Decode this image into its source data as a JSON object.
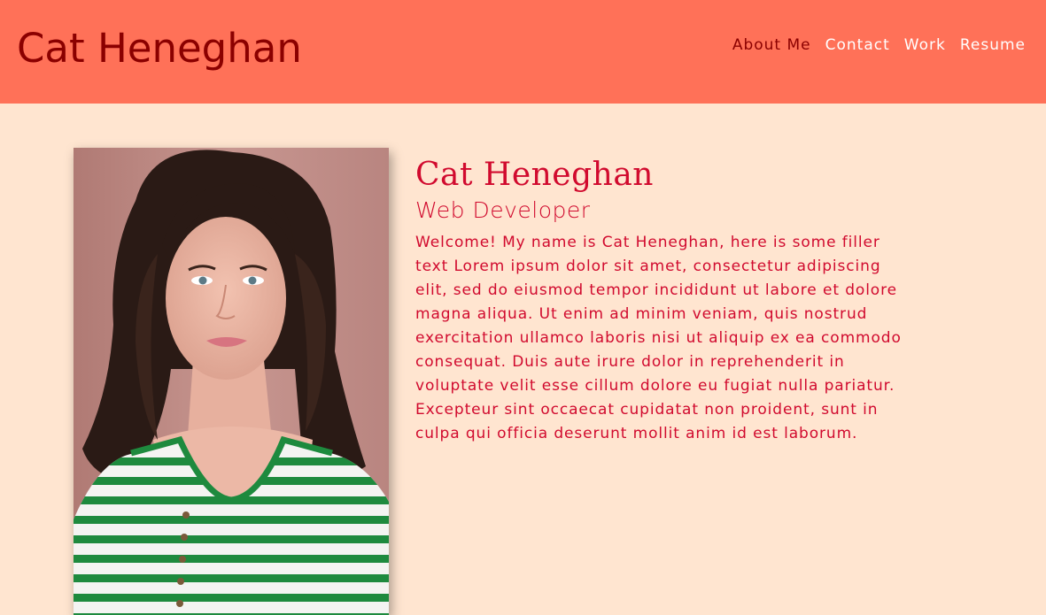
{
  "header": {
    "site_title": "Cat Heneghan",
    "nav": [
      {
        "label": "About Me",
        "active": true
      },
      {
        "label": "Contact",
        "active": false
      },
      {
        "label": "Work",
        "active": false
      },
      {
        "label": "Resume",
        "active": false
      }
    ]
  },
  "profile": {
    "photo_icon": "portrait-photo",
    "name": "Cat Heneghan",
    "role": "Web Developer",
    "bio": "Welcome! My name is Cat Heneghan, here is some filler text Lorem ipsum dolor sit amet, consectetur adipiscing elit, sed do eiusmod tempor incididunt ut labore et dolore magna aliqua. Ut enim ad minim veniam, quis nostrud exercitation ullamco laboris nisi ut aliquip ex ea commodo consequat. Duis aute irure dolor in reprehenderit in voluptate velit esse cillum dolore eu fugiat nulla pariatur. Excepteur sint occaecat cupidatat non proident, sunt in culpa qui officia deserunt mollit anim id est laborum."
  },
  "colors": {
    "header_bg": "#ff7158",
    "page_bg": "#ffe5d0",
    "title_text": "#8b0000",
    "nav_text": "#ffffff",
    "accent_text": "#d10a2e"
  }
}
